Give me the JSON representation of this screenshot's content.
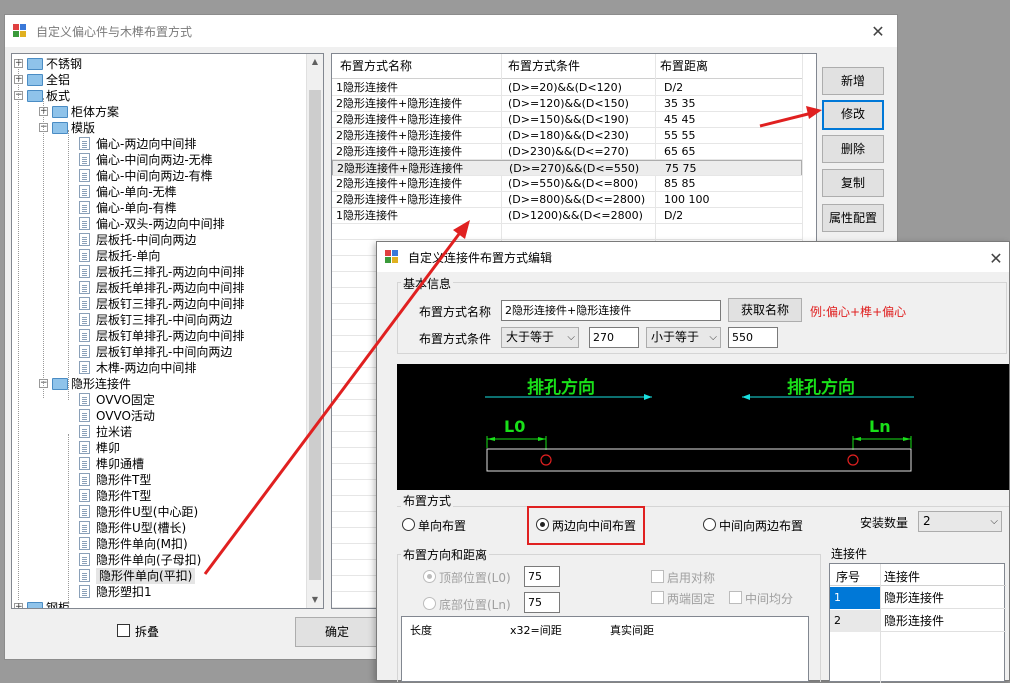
{
  "main_window": {
    "title": "自定义偏心件与木榫布置方式",
    "close": "✕",
    "tree": {
      "items": [
        {
          "label": "不锈钢",
          "level": 1,
          "type": "folder",
          "expander": "+"
        },
        {
          "label": "全铝",
          "level": 1,
          "type": "folder",
          "expander": "+"
        },
        {
          "label": "板式",
          "level": 1,
          "type": "folder",
          "expander": "−"
        },
        {
          "label": "柜体方案",
          "level": 2,
          "type": "folder",
          "expander": "+"
        },
        {
          "label": "模版",
          "level": 2,
          "type": "folder",
          "expander": "−"
        },
        {
          "label": "偏心-两边向中间排",
          "level": 3,
          "type": "doc"
        },
        {
          "label": "偏心-中间向两边-无榫",
          "level": 3,
          "type": "doc"
        },
        {
          "label": "偏心-中间向两边-有榫",
          "level": 3,
          "type": "doc"
        },
        {
          "label": "偏心-单向-无榫",
          "level": 3,
          "type": "doc"
        },
        {
          "label": "偏心-单向-有榫",
          "level": 3,
          "type": "doc"
        },
        {
          "label": "偏心-双头-两边向中间排",
          "level": 3,
          "type": "doc"
        },
        {
          "label": "层板托-中间向两边",
          "level": 3,
          "type": "doc"
        },
        {
          "label": "层板托-单向",
          "level": 3,
          "type": "doc"
        },
        {
          "label": "层板托三排孔-两边向中间排",
          "level": 3,
          "type": "doc"
        },
        {
          "label": "层板托单排孔-两边向中间排",
          "level": 3,
          "type": "doc"
        },
        {
          "label": "层板钉三排孔-两边向中间排",
          "level": 3,
          "type": "doc"
        },
        {
          "label": "层板钉三排孔-中间向两边",
          "level": 3,
          "type": "doc"
        },
        {
          "label": "层板钉单排孔-两边向中间排",
          "level": 3,
          "type": "doc"
        },
        {
          "label": "层板钉单排孔-中间向两边",
          "level": 3,
          "type": "doc"
        },
        {
          "label": "木榫-两边向中间排",
          "level": 3,
          "type": "doc"
        },
        {
          "label": "隐形连接件",
          "level": 2,
          "type": "folder",
          "expander": "−"
        },
        {
          "label": "OVVO固定",
          "level": 3,
          "type": "doc"
        },
        {
          "label": "OVVO活动",
          "level": 3,
          "type": "doc"
        },
        {
          "label": "拉米诺",
          "level": 3,
          "type": "doc"
        },
        {
          "label": "榫卯",
          "level": 3,
          "type": "doc"
        },
        {
          "label": "榫卯通槽",
          "level": 3,
          "type": "doc"
        },
        {
          "label": "隐形件T型",
          "level": 3,
          "type": "doc"
        },
        {
          "label": "隐形件T型",
          "level": 3,
          "type": "doc"
        },
        {
          "label": "隐形件U型(中心距)",
          "level": 3,
          "type": "doc"
        },
        {
          "label": "隐形件U型(槽长)",
          "level": 3,
          "type": "doc"
        },
        {
          "label": "隐形件单向(M扣)",
          "level": 3,
          "type": "doc"
        },
        {
          "label": "隐形件单向(子母扣)",
          "level": 3,
          "type": "doc"
        },
        {
          "label": "隐形件单向(平扣)",
          "level": 3,
          "type": "doc",
          "selected": true
        },
        {
          "label": "隐形塑扣1",
          "level": 3,
          "type": "doc"
        },
        {
          "label": "钢柜",
          "level": 1,
          "type": "folder",
          "expander": "+"
        }
      ]
    },
    "grid": {
      "headers": [
        "布置方式名称",
        "布置方式条件",
        "布置距离"
      ],
      "rows": [
        [
          "1隐形连接件",
          "(D>=20)&&(D<120)",
          "D/2"
        ],
        [
          "2隐形连接件+隐形连接件",
          "(D>=120)&&(D<150)",
          "35 35"
        ],
        [
          "2隐形连接件+隐形连接件",
          "(D>=150)&&(D<190)",
          "45 45"
        ],
        [
          "2隐形连接件+隐形连接件",
          "(D>=180)&&(D<230)",
          "55 55"
        ],
        [
          "2隐形连接件+隐形连接件",
          "(D>230)&&(D<=270)",
          "65 65"
        ],
        [
          "2隐形连接件+隐形连接件",
          "(D>=270)&&(D<=550)",
          "75 75"
        ],
        [
          "2隐形连接件+隐形连接件",
          "(D>=550)&&(D<=800)",
          "85 85"
        ],
        [
          "2隐形连接件+隐形连接件",
          "(D>=800)&&(D<=2800)",
          "100 100"
        ],
        [
          "1隐形连接件",
          "(D>1200)&&(D<=2800)",
          "D/2"
        ]
      ],
      "selected_row": 5
    },
    "buttons": {
      "add": "新增",
      "edit": "修改",
      "delete": "删除",
      "copy": "复制",
      "props": "属性配置",
      "ok": "确定"
    },
    "collapse_checkbox": "拆叠"
  },
  "edit_dialog": {
    "title": "自定义连接件布置方式编辑",
    "close": "✕",
    "basic_group": "基本信息",
    "name_label": "布置方式名称",
    "name_value": "2隐形连接件+隐形连接件",
    "get_name_button": "获取名称",
    "example_text": "例:偏心+榫+偏心",
    "cond_label": "布置方式条件",
    "cond_op1": "大于等于",
    "cond_val1": "270",
    "cond_op2": "小于等于",
    "cond_val2": "550",
    "preview": {
      "left_direction": "排孔方向",
      "right_direction": "排孔方向",
      "left_label": "L0",
      "right_label": "Ln"
    },
    "layout_group": "布置方式",
    "radio_single": "单向布置",
    "radio_both_to_center": "两边向中间布置",
    "radio_center_to_both": "中间向两边布置",
    "qty_label": "安装数量",
    "qty_value": "2",
    "dir_group": "布置方向和距离",
    "top_pos_label": "顶部位置(L0)",
    "top_pos_value": "75",
    "bottom_pos_label": "底部位置(Ln)",
    "bottom_pos_value": "75",
    "enable_symmetry": "启用对称",
    "both_ends_fixed": "两端固定",
    "center_even": "中间均分",
    "dist_table_headers": [
      "长度",
      "x32=间距",
      "真实间距"
    ],
    "connector_group": "连接件",
    "connector_headers": [
      "序号",
      "连接件"
    ],
    "connectors": [
      {
        "index": "1",
        "name": "隐形连接件"
      },
      {
        "index": "2",
        "name": "隐形连接件"
      }
    ]
  },
  "colors": {
    "accent": "#0078d7",
    "annotation_red": "#e02020",
    "cad_green": "#19e019",
    "cad_cyan": "#19e0e0"
  }
}
